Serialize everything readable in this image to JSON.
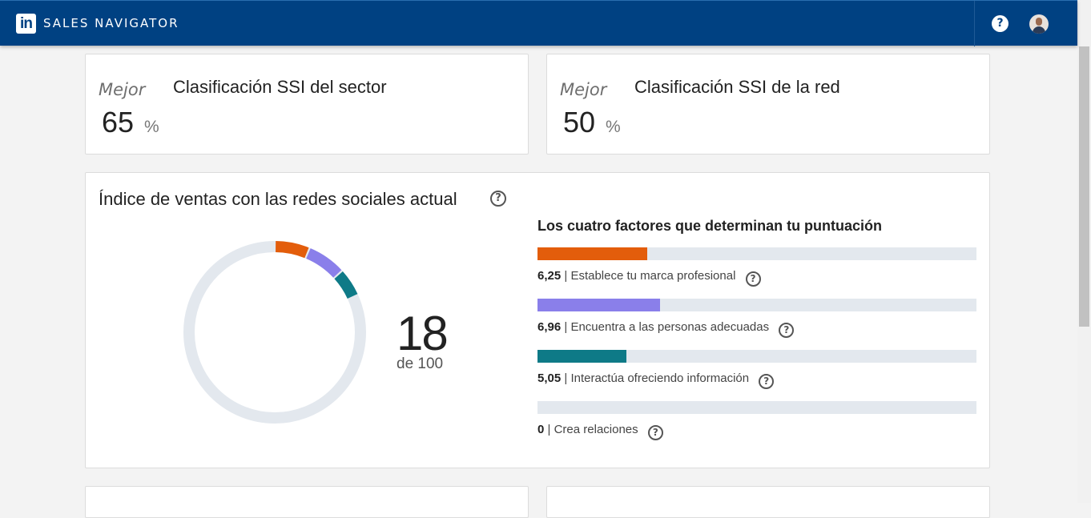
{
  "header": {
    "logo_text": "in",
    "brand": "SALES NAVIGATOR",
    "help_label": "?"
  },
  "industry_card": {
    "label": "Mejor",
    "value": "65",
    "unit": "%",
    "title": "Clasificación SSI del sector"
  },
  "network_card": {
    "label": "Mejor",
    "value": "50",
    "unit": "%",
    "title": "Clasificación SSI de la red"
  },
  "ssi": {
    "title": "Índice de ventas con las redes sociales actual",
    "help_label": "?",
    "score": "18",
    "score_of": "de 100",
    "factors_title": "Los cuatro factores que determinan tu puntuación",
    "factors": [
      {
        "value": "6,25",
        "label": "Establece tu marca profesional",
        "fill": 0.25,
        "color": "#e35d0b"
      },
      {
        "value": "6,96",
        "label": "Encuentra a las personas adecuadas",
        "fill": 0.2784,
        "color": "#8a7fea"
      },
      {
        "value": "5,05",
        "label": "Interactúa ofreciendo información",
        "fill": 0.202,
        "color": "#0e7a87"
      },
      {
        "value": "0",
        "label": "Crea relaciones",
        "fill": 0,
        "color": "#c94a8e"
      }
    ],
    "separator": "|",
    "ring_color": "#e3e8ee"
  }
}
